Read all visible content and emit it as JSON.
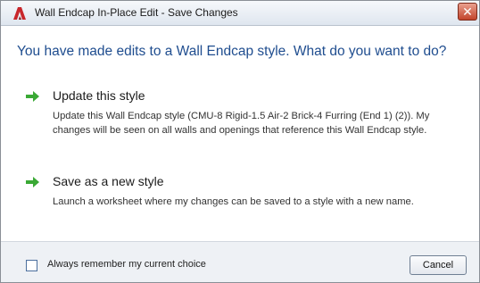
{
  "window": {
    "title": "Wall Endcap In-Place Edit - Save Changes",
    "close_glyph": "✕",
    "app_icon": "autocad-logo-icon",
    "close_icon": "close-icon"
  },
  "heading": "You have made edits to a Wall Endcap style. What do you want to do?",
  "options": [
    {
      "title": "Update this style",
      "description": "Update this Wall Endcap style (CMU-8 Rigid-1.5 Air-2 Brick-4 Furring (End 1) (2)). My changes will be seen on all walls and openings that reference this Wall Endcap style.",
      "icon": "green-arrow-icon"
    },
    {
      "title": "Save as a new style",
      "description": "Launch a worksheet where my changes can be saved to a style with a new name.",
      "icon": "green-arrow-icon"
    }
  ],
  "footer": {
    "checkbox_label": "Always remember my current choice",
    "checkbox_checked": false,
    "cancel_label": "Cancel"
  },
  "colors": {
    "heading": "#1f4d8f",
    "arrow": "#3aa935",
    "close_button": "#c2442c",
    "footer_bg": "#eef1f5"
  }
}
